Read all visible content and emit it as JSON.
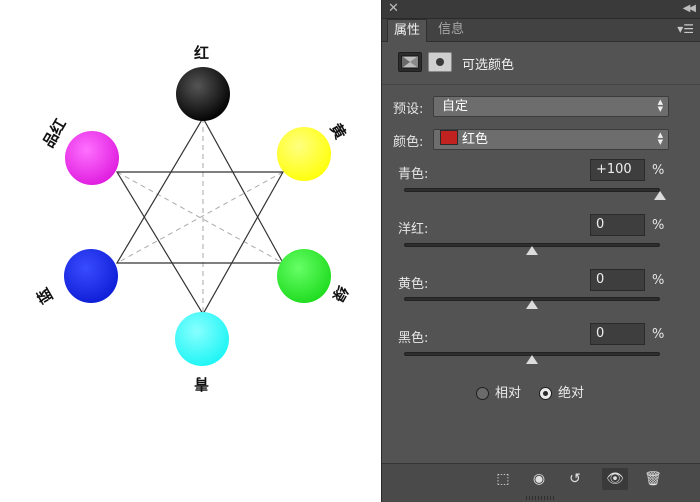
{
  "wheel": {
    "labels": {
      "red": "红",
      "yellow": "黄",
      "green": "绿",
      "cyan": "青",
      "blue": "蓝",
      "magenta": "品红"
    },
    "colors": {
      "red": "#111111",
      "yellow": "#ffff2a",
      "green": "#33ee33",
      "cyan": "#33ffff",
      "blue": "#1a2ae8",
      "magenta": "#f030f0"
    }
  },
  "panel": {
    "tabs": [
      "属性",
      "信息"
    ],
    "title": "可选颜色",
    "preset_label": "预设:",
    "preset_value": "自定",
    "colors_label": "颜色:",
    "colors_value": "红色",
    "colors_swatch": "#c1221f",
    "sliders": [
      {
        "label": "青色:",
        "value": "+100",
        "unit": "%",
        "percent": 100
      },
      {
        "label": "洋红:",
        "value": "0",
        "unit": "%",
        "percent": 0
      },
      {
        "label": "黄色:",
        "value": "0",
        "unit": "%",
        "percent": 0
      },
      {
        "label": "黑色:",
        "value": "0",
        "unit": "%",
        "percent": 0
      }
    ],
    "method": {
      "relative": "相对",
      "absolute": "绝对",
      "selected": "absolute"
    },
    "accent": "#535353"
  }
}
